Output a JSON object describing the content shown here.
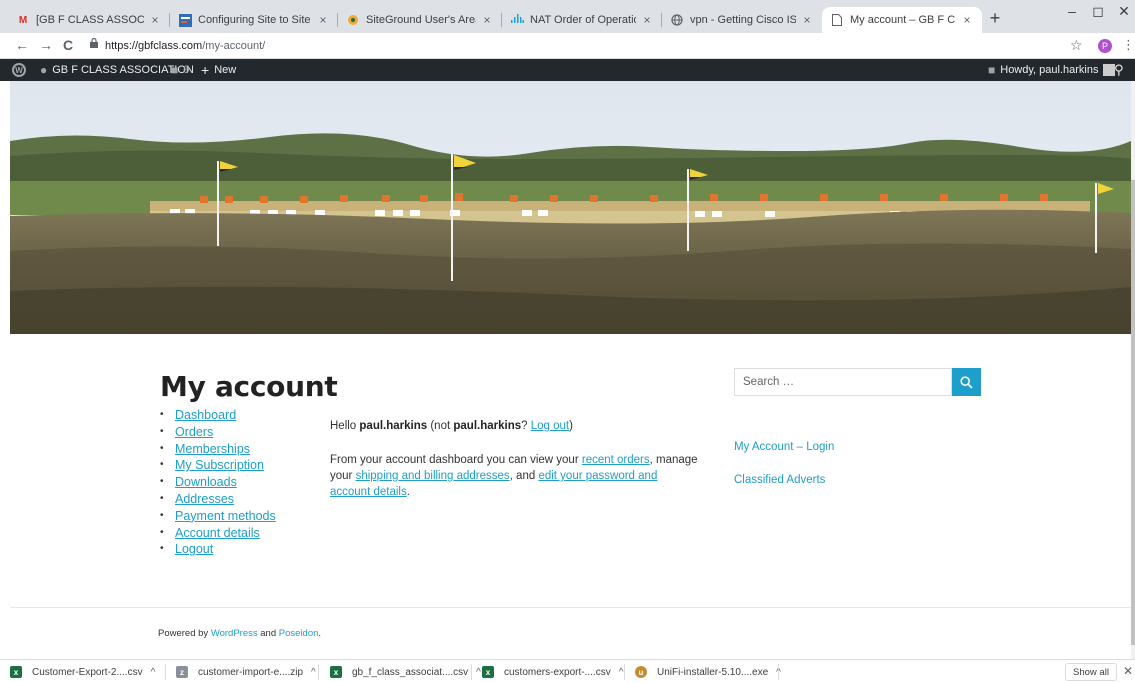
{
  "browser": {
    "tabs": [
      {
        "title": "[GB F CLASS ASSOCIATION] Pass",
        "icon": "gmail-icon",
        "active": false
      },
      {
        "title": "Configuring Site to Site IPSec VP",
        "icon": "doc-icon",
        "active": false
      },
      {
        "title": "SiteGround User's Area",
        "icon": "siteground-icon",
        "active": false
      },
      {
        "title": "NAT Order of Operation - Cisco",
        "icon": "cisco-icon",
        "active": false
      },
      {
        "title": "vpn - Getting Cisco ISAKMP and",
        "icon": "globe-icon",
        "active": false
      },
      {
        "title": "My account – GB F CLASS ASSOC",
        "icon": "page-icon",
        "active": true
      }
    ],
    "tab_close": "×",
    "new_tab": "+",
    "window_controls": {
      "minimize": "–",
      "maximize": "◻",
      "close": "✕"
    },
    "nav": {
      "back": "←",
      "forward": "→",
      "reload": "C"
    },
    "url_host": "https://gbfclass.com",
    "url_path": "/my-account/",
    "star": "☆",
    "profile_initial": "P",
    "menu": "⋮"
  },
  "admin_bar": {
    "site_name": "GB F CLASS ASSOCIATION",
    "comments_count": "0",
    "new_label": "New",
    "howdy": "Howdy, paul.harkins",
    "wp_logo": "W",
    "search": "⚲"
  },
  "account": {
    "title": "My account",
    "nav": [
      {
        "label": "Dashboard",
        "name": "dashboard"
      },
      {
        "label": "Orders",
        "name": "orders"
      },
      {
        "label": "Memberships",
        "name": "memberships"
      },
      {
        "label": "My Subscription",
        "name": "my-subscription"
      },
      {
        "label": "Downloads",
        "name": "downloads"
      },
      {
        "label": "Addresses",
        "name": "addresses"
      },
      {
        "label": "Payment methods",
        "name": "payment-methods"
      },
      {
        "label": "Account details",
        "name": "account-details"
      },
      {
        "label": "Logout",
        "name": "logout"
      }
    ],
    "bullet": "•",
    "hello_prefix": "Hello ",
    "username": "paul.harkins",
    "hello_mid": " (not ",
    "hello_q": "? ",
    "logout_link": "Log out",
    "hello_suffix": ")",
    "blurb_1": "From your account dashboard you can view your ",
    "recent_orders": "recent orders",
    "blurb_2": ", manage your ",
    "shipping_link": "shipping and billing addresses",
    "blurb_3": ", and ",
    "edit_link": "edit your password and account details",
    "blurb_4": "."
  },
  "sidebar": {
    "search_placeholder": "Search …",
    "links": [
      "My Account – Login",
      "Classified Adverts"
    ]
  },
  "footer": {
    "prefix": "Powered by ",
    "wordpress": "WordPress",
    "and": " and ",
    "theme": "Poseidon",
    "suffix": "."
  },
  "downloads": {
    "items": [
      {
        "name": "Customer-Export-2....csv",
        "icon": "csv-icon"
      },
      {
        "name": "customer-import-e....zip",
        "icon": "zip-icon"
      },
      {
        "name": "gb_f_class_associat....csv",
        "icon": "csv-icon"
      },
      {
        "name": "customers-export-....csv",
        "icon": "csv-icon"
      },
      {
        "name": "UniFi-installer-5.10....exe",
        "icon": "installer-icon"
      }
    ],
    "caret": "^",
    "show_all": "Show all",
    "close": "✕"
  },
  "colors": {
    "link": "#1e9ecb",
    "admin_bar": "#23282d",
    "tab_strip": "#dee1e6",
    "search_button": "#1e9ecb"
  }
}
